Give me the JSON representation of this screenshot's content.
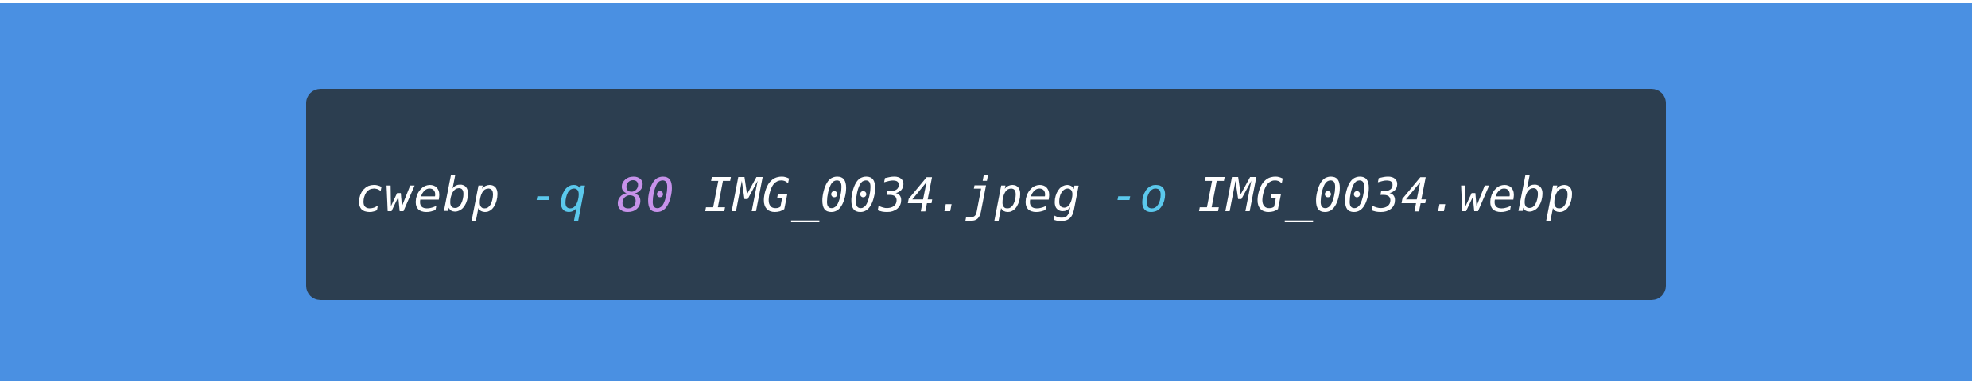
{
  "command": {
    "program": "cwebp",
    "quality_flag": "-q",
    "quality_value": "80",
    "input_file": "IMG_0034.jpeg",
    "output_flag": "-o",
    "output_file": "IMG_0034.webp"
  },
  "colors": {
    "background": "#4a90e2",
    "code_block": "#2c3e50",
    "text": "#ffffff",
    "flag": "#5bc8ec",
    "number": "#c792ea"
  }
}
